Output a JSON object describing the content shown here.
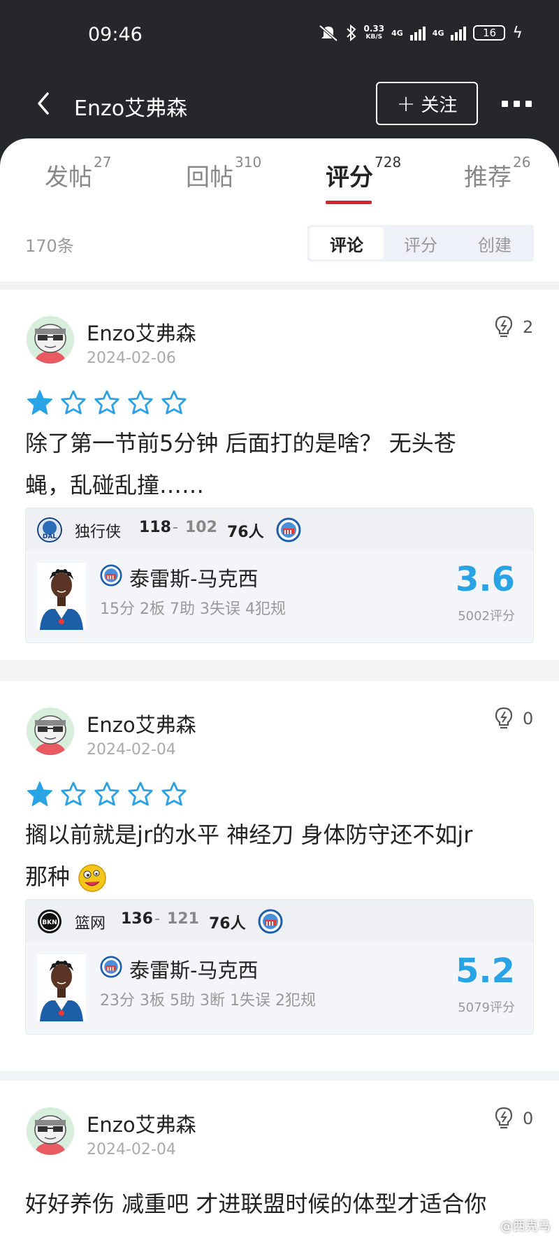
{
  "status": {
    "time": "09:46",
    "net_speed_value": "0.33",
    "net_speed_unit": "KB/S",
    "net1": "4G",
    "net2": "4G",
    "battery": "16"
  },
  "header": {
    "title": "Enzo艾弗森",
    "follow_label": "关注"
  },
  "tabs": [
    {
      "label": "发帖",
      "count": "27"
    },
    {
      "label": "回帖",
      "count": "310"
    },
    {
      "label": "评分",
      "count": "728"
    },
    {
      "label": "推荐",
      "count": "26"
    }
  ],
  "active_tab": "评分",
  "filter": {
    "total": "170条",
    "options": [
      "评论",
      "评分",
      "创建"
    ],
    "active": "评论"
  },
  "posts": [
    {
      "username": "Enzo艾弗森",
      "date": "2024-02-06",
      "likes": "2",
      "stars": 1,
      "comment_lines": [
        "除了第一节前5分钟 后面打的是啥？ 无头苍",
        "蝇，乱碰乱撞……"
      ],
      "game": {
        "team1": "独行侠",
        "score1": "118",
        "score2": "102",
        "team2": "76人"
      },
      "player": {
        "name": "泰雷斯-马克西",
        "stats": "15分 2板 7助 3失误 4犯规",
        "rating": "3.6",
        "rating_count": "5002评分"
      }
    },
    {
      "username": "Enzo艾弗森",
      "date": "2024-02-04",
      "likes": "0",
      "stars": 1,
      "comment_lines": [
        "搁以前就是jr的水平  神经刀 身体防守还不如jr",
        "那种"
      ],
      "game": {
        "team1": "篮网",
        "score1": "136",
        "score2": "121",
        "team2": "76人"
      },
      "player": {
        "name": "泰雷斯-马克西",
        "stats": "23分 3板 5助 3断 1失误 2犯规",
        "rating": "5.2",
        "rating_count": "5079评分"
      }
    },
    {
      "username": "Enzo艾弗森",
      "date": "2024-02-04",
      "likes": "0",
      "comment_lines": [
        "好好养伤 减重吧 才进联盟时候的体型才适合你"
      ]
    }
  ],
  "watermark": "@西克马",
  "colors": {
    "accent_red": "#d7232c",
    "rating_blue": "#2aa3e5",
    "star_blue": "#2aa3e5",
    "header_dark": "#26272b"
  }
}
